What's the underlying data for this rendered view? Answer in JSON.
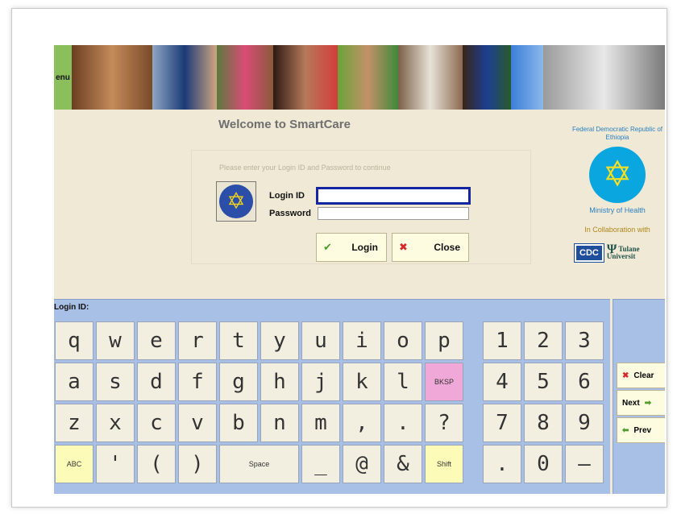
{
  "banner": {
    "menu_label": "enu"
  },
  "welcome": {
    "title": "Welcome to SmartCare",
    "prompt": "Please enter your Login ID and Password to continue",
    "login_id_label": "Login ID",
    "password_label": "Password",
    "login_id_value": "",
    "password_value": "",
    "login_button": "Login",
    "close_button": "Close"
  },
  "ministry": {
    "top_text": "Federal Democratic Republic of Ethiopia",
    "name": "Ministry of Health",
    "collab": "In Collaboration with",
    "cdc": "CDC",
    "tulane": "Tulane Universit"
  },
  "keyboard": {
    "label": "Login ID:",
    "row1": [
      "q",
      "w",
      "e",
      "r",
      "t",
      "y",
      "u",
      "i",
      "o",
      "p"
    ],
    "row2": [
      "a",
      "s",
      "d",
      "f",
      "g",
      "h",
      "j",
      "k",
      "l",
      "BKSP"
    ],
    "row3": [
      "z",
      "x",
      "c",
      "v",
      "b",
      "n",
      "m",
      ",",
      ".",
      "?"
    ],
    "row4": [
      "ABC",
      "'",
      "(",
      ")",
      "Space",
      "_",
      "@",
      "&",
      "Shift"
    ],
    "num1": [
      "1",
      "2",
      "3"
    ],
    "num2": [
      "4",
      "5",
      "6"
    ],
    "num3": [
      "7",
      "8",
      "9"
    ],
    "num4": [
      ".",
      "0",
      "–"
    ]
  },
  "side": {
    "clear": "Clear",
    "next": "Next",
    "prev": "Prev"
  },
  "colors": {
    "accent_blue": "#1427a0",
    "keyboard_bg": "#a9c0e6",
    "key_pink": "#f0a8d8",
    "key_yellow": "#fcfbb8"
  }
}
